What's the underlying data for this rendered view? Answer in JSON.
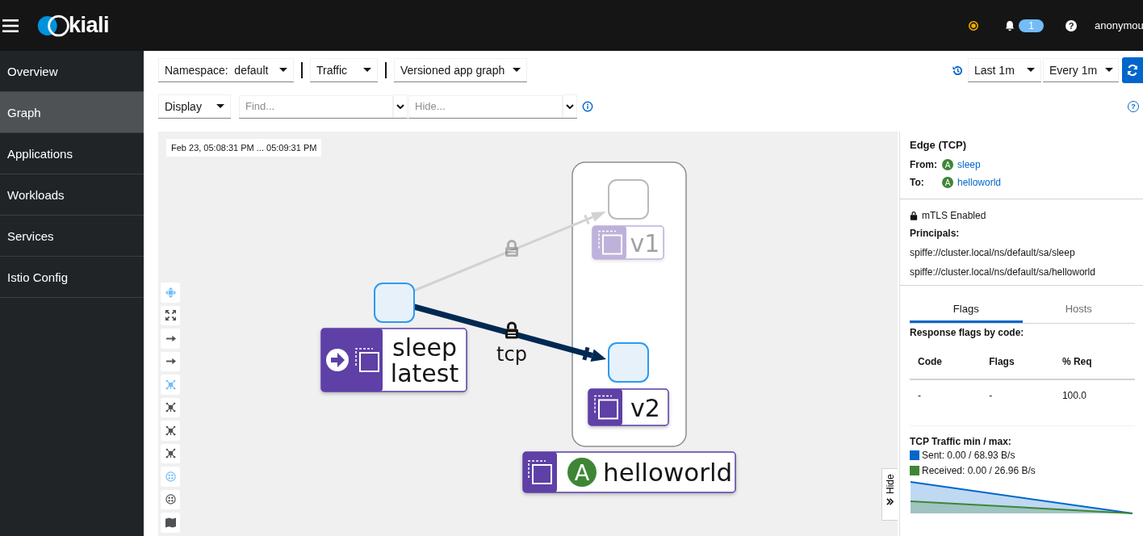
{
  "header": {
    "logo": "kiali",
    "notifications": "1",
    "help": "?",
    "user": "anonymou"
  },
  "sidebar": {
    "items": [
      {
        "label": "Overview",
        "selected": false
      },
      {
        "label": "Graph",
        "selected": true
      },
      {
        "label": "Applications",
        "selected": false
      },
      {
        "label": "Workloads",
        "selected": false
      },
      {
        "label": "Services",
        "selected": false
      },
      {
        "label": "Istio Config",
        "selected": false
      }
    ]
  },
  "toolbar": {
    "namespace_label": "Namespace:",
    "namespace": "default",
    "traffic": "Traffic",
    "graph_type": "Versioned app graph",
    "time_range": "Last 1m",
    "refresh_interval": "Every 1m",
    "display": "Display",
    "help": "?",
    "find": {
      "placeholder": "Find..."
    },
    "hide": {
      "placeholder": "Hide..."
    }
  },
  "graph": {
    "timestamp": "Feb 23, 05:08:31 PM ... 05:09:31 PM",
    "tools": [
      {
        "kind": "pan",
        "on": true
      },
      {
        "kind": "fit",
        "on": false
      },
      {
        "kind": "arrow",
        "on": false
      },
      {
        "kind": "arrow",
        "on": false
      },
      {
        "kind": "cluster",
        "on": true
      },
      {
        "kind": "cluster",
        "on": false
      },
      {
        "kind": "cluster",
        "on": false
      },
      {
        "kind": "cluster",
        "on": false
      },
      {
        "kind": "boxes",
        "on": true
      },
      {
        "kind": "boxes",
        "on": false
      },
      {
        "kind": "map",
        "on": false
      }
    ],
    "app_box": {
      "badge": "A",
      "label": "helloworld"
    },
    "nodes": [
      {
        "lines": [
          "sleep",
          "latest"
        ],
        "entry": true,
        "faded": false
      },
      {
        "lines": [
          "v1"
        ],
        "entry": false,
        "faded": true
      },
      {
        "lines": [
          "v2"
        ],
        "entry": false,
        "faded": false
      }
    ],
    "edges": [
      {
        "faded": true
      },
      {
        "faded": false,
        "label": "tcp"
      }
    ],
    "hide_tab": "Hide"
  },
  "panel": {
    "title": "Edge (TCP)",
    "from_label": "From:",
    "from_badge": "A",
    "from": "sleep",
    "to_label": "To:",
    "to_badge": "A",
    "to": "helloworld",
    "mtls": "mTLS Enabled",
    "principals_label": "Principals:",
    "principals": [
      "spiffe://cluster.local/ns/default/sa/sleep",
      "spiffe://cluster.local/ns/default/sa/helloworld"
    ],
    "tabs": [
      {
        "label": "Flags",
        "selected": true
      },
      {
        "label": "Hosts",
        "selected": false
      }
    ],
    "flags_title": "Response flags by code:",
    "table": {
      "columns": [
        "Code",
        "Flags",
        "% Req"
      ],
      "rows": [
        [
          "-",
          "-",
          "100.0"
        ]
      ]
    },
    "traffic_title": "TCP Traffic min / max:",
    "legend": [
      {
        "label": "Sent: 0.00 / 68.93 B/s",
        "color": "#0066cc"
      },
      {
        "label": "Received: 0.00 / 26.96 B/s",
        "color": "#3e8635"
      }
    ]
  }
}
